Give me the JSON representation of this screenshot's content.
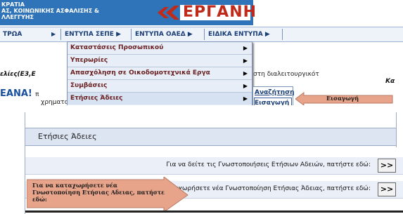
{
  "header": {
    "org_line1": "ΚΡΑΤΙΑ",
    "org_line2": "ΑΣ, ΚΟΙΝΩΝΙΚΗΣ ΑΣΦΑΛΙΣΗΣ &",
    "org_line3": "ΛΛΕΓΓΥΗΣ",
    "logo_text": "ΕΡΓΑΝΗ"
  },
  "menubar": {
    "items": [
      {
        "label": "ΤΡΩΑ"
      },
      {
        "label": "ΕΝΤΥΠΑ ΣΕΠΕ ▶"
      },
      {
        "label": "ΕΝΤΥΠΑ ΟΑΕΔ ▶"
      },
      {
        "label": "ΕΙΔΙΚΑ ΕΝΤΥΠΑ ▶"
      }
    ]
  },
  "dropdown": {
    "items": [
      {
        "label": "Καταστάσεις Προσωπικού"
      },
      {
        "label": "Υπερωρίες"
      },
      {
        "label": "Απασχόληση σε Οικοδομοτεχνικά Εργα"
      },
      {
        "label": "Συμβάσεις"
      },
      {
        "label": "Ετήσιες Άδειες"
      }
    ],
    "arrow": "▶"
  },
  "submenu": {
    "items": [
      {
        "label": "Αναζήτηση"
      },
      {
        "label": "Εισαγωγή"
      }
    ]
  },
  "background_text": {
    "line1": "ελίες(Ε3,Ε",
    "line2": "στη διαλειτουργικότ",
    "line3": "Κα",
    "big": "ΕΑΝΑ!",
    "big_suffix": "π",
    "line4": "χρηματοδότηση του 70% της ελάχιστης αμοιβής, μ"
  },
  "callouts": {
    "insert_label": "Εισαγωγή",
    "new_notice": "Για να καταχωρήσετε νέα Γνωστοποίηση Ετήσιας Αδειας, πατήστε εδώ:"
  },
  "panel": {
    "title": "Ετήσιες Άδειες",
    "rows": [
      {
        "text": "Για να δείτε τις Γνωστοποιήσεις Ετήσιων Αδειών, πατήστε εδώ:",
        "button": ">>"
      },
      {
        "text": "Για να καταχωρήσετε νέα Γνωστοποίηση Ετήσιας Άδειας, πατήστε εδώ:",
        "button": ">>"
      }
    ]
  },
  "colors": {
    "accent_blue": "#2f74b8",
    "callout_orange": "#e8a48a",
    "logo_red": "#c02a1a"
  }
}
